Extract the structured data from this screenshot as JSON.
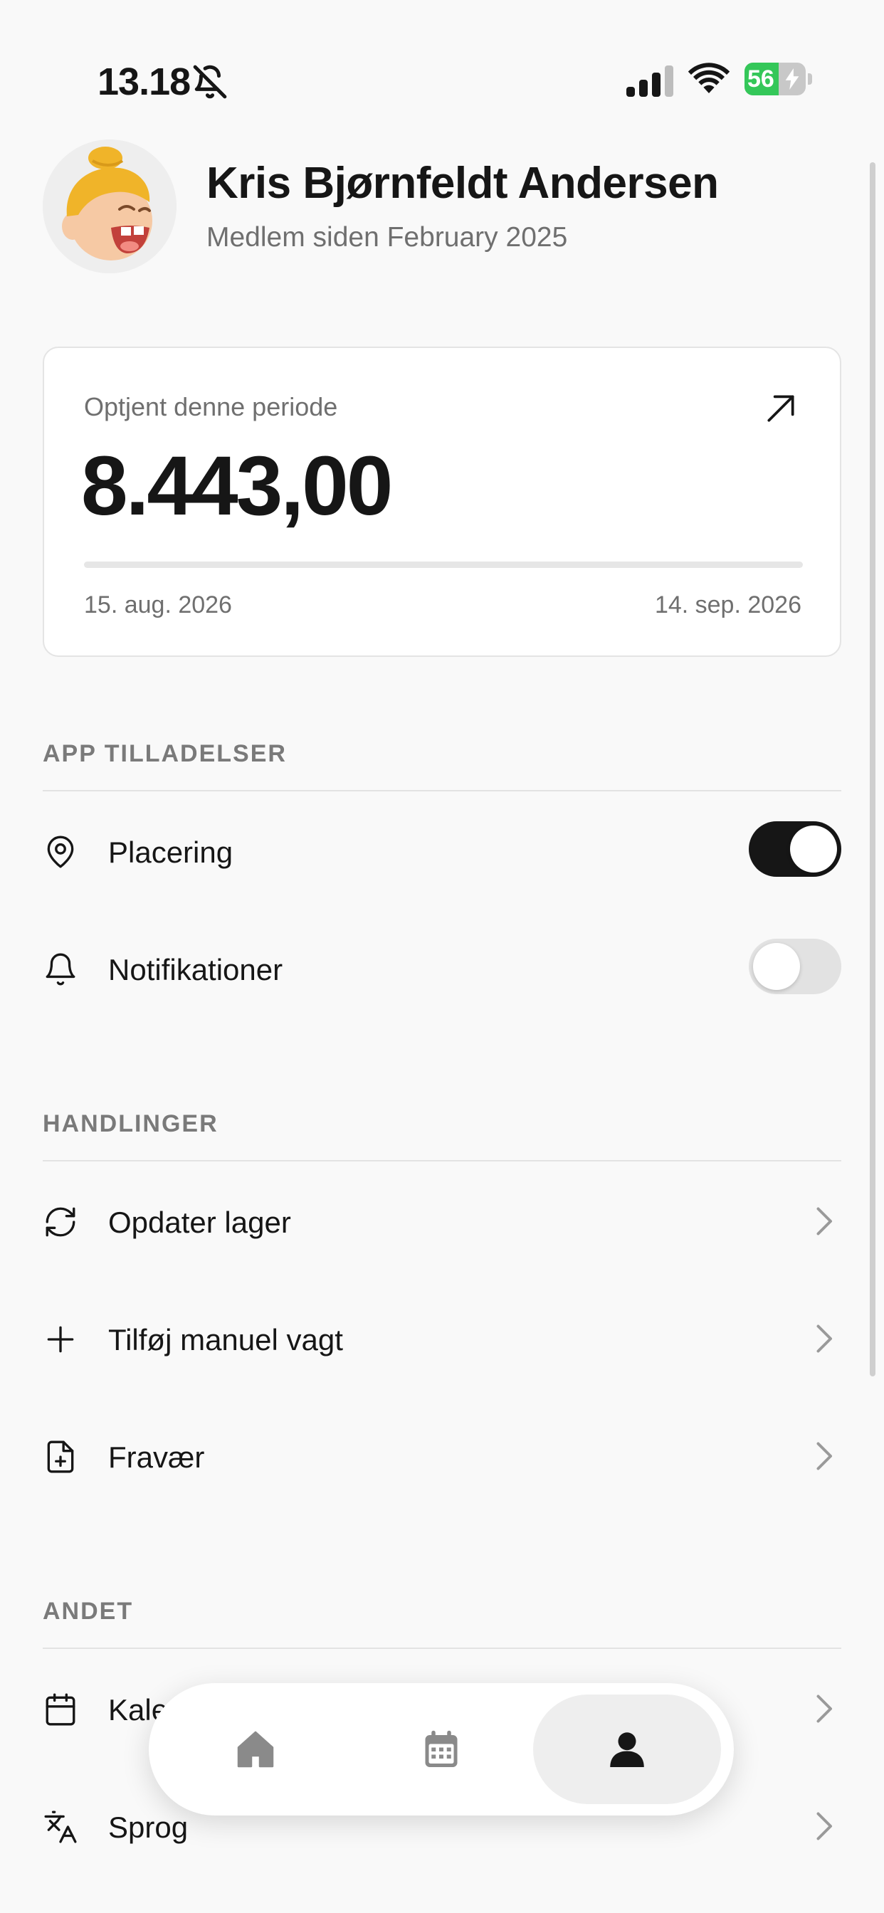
{
  "status_bar": {
    "time": "13.18",
    "battery": "56",
    "battery_level": 0.56
  },
  "profile": {
    "name": "Kris Bjørnfeldt Andersen",
    "member_since": "Medlem siden February 2025"
  },
  "earnings": {
    "label": "Optjent denne periode",
    "amount": "8.443,00",
    "period_start": "15. aug. 2026",
    "period_end": "14. sep. 2026",
    "progress": 0
  },
  "permissions": {
    "title": "APP TILLADELSER",
    "items": [
      {
        "label": "Placering",
        "icon": "map-pin-icon",
        "enabled": true
      },
      {
        "label": "Notifikationer",
        "icon": "bell-icon",
        "enabled": false
      }
    ]
  },
  "actions": {
    "title": "HANDLINGER",
    "items": [
      {
        "label": "Opdater lager",
        "icon": "refresh-icon"
      },
      {
        "label": "Tilføj manuel vagt",
        "icon": "plus-icon"
      },
      {
        "label": "Fravær",
        "icon": "file-plus-icon"
      }
    ]
  },
  "other": {
    "title": "ANDET",
    "items": [
      {
        "label": "Kalender",
        "icon": "calendar-icon"
      },
      {
        "label": "Sprog",
        "icon": "translate-icon"
      }
    ]
  },
  "tabbar": {
    "tabs": [
      {
        "icon": "home-icon",
        "active": false
      },
      {
        "icon": "calendar-icon",
        "active": false
      },
      {
        "icon": "profile-icon",
        "active": true
      }
    ]
  },
  "colors": {
    "background": "#f9f9f9",
    "text": "#161616",
    "muted": "#6f6f6f",
    "toggle_on": "#161616",
    "battery": "#34c759"
  }
}
